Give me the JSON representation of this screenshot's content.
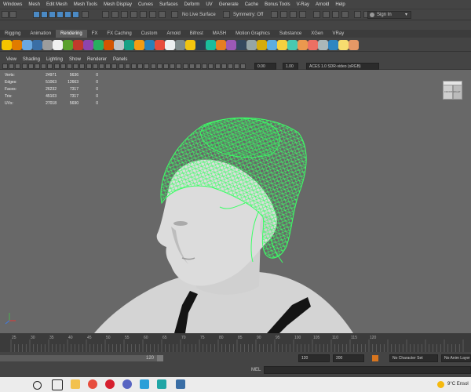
{
  "menubar": [
    "Windows",
    "Mesh",
    "Edit Mesh",
    "Mesh Tools",
    "Mesh Display",
    "Curves",
    "Surfaces",
    "Deform",
    "UV",
    "Generate",
    "Cache",
    "Bonus Tools",
    "V-Ray",
    "Arnold",
    "Help"
  ],
  "statusline": {
    "no_live_surface": "No Live Surface",
    "symmetry": "Symmetry: Off",
    "sign_in": "Sign In"
  },
  "shelf_tabs": [
    "Rigging",
    "Animation",
    "Rendering",
    "FX",
    "FX Caching",
    "Custom",
    "Arnold",
    "Bifrost",
    "MASH",
    "Motion Graphics",
    "Substance",
    "XGen",
    "VRay"
  ],
  "viewport_menu": [
    "View",
    "Shading",
    "Lighting",
    "Show",
    "Renderer",
    "Panels"
  ],
  "viewport_toolbar": {
    "field1": "0.00",
    "field2": "1.00",
    "color_space": "ACES 1.0 SDR-video (sRGB)"
  },
  "hud": {
    "rows": [
      {
        "label": "Verts:",
        "v1": "24971",
        "v2": "5636",
        "v3": "0"
      },
      {
        "label": "Edges:",
        "v1": "51063",
        "v2": "12663",
        "v3": "0"
      },
      {
        "label": "Faces:",
        "v1": "26232",
        "v2": "7317",
        "v3": "0"
      },
      {
        "label": "Tris:",
        "v1": "45103",
        "v2": "7317",
        "v3": "0"
      },
      {
        "label": "UVs:",
        "v1": "27018",
        "v2": "5690",
        "v3": "0"
      }
    ]
  },
  "viewcube_label": "FRONT RIGHT",
  "timeline": {
    "ticks": [
      "25",
      "30",
      "35",
      "40",
      "45",
      "50",
      "55",
      "60",
      "65",
      "70",
      "75",
      "80",
      "85",
      "90",
      "95",
      "100",
      "105",
      "110",
      "115",
      "120"
    ]
  },
  "range": {
    "end_value": "120",
    "field_a": "120",
    "field_b": "200",
    "no_character_set": "No Character Set",
    "no_anim_layer": "No Anim Layer"
  },
  "mel": {
    "label": "MEL"
  },
  "taskbar": {
    "weather": "9°C Ensol"
  },
  "colors": {
    "viewport_bg": "#686868",
    "hair_wireframe": "#40ff6a",
    "skin": "#d8d8d8"
  }
}
